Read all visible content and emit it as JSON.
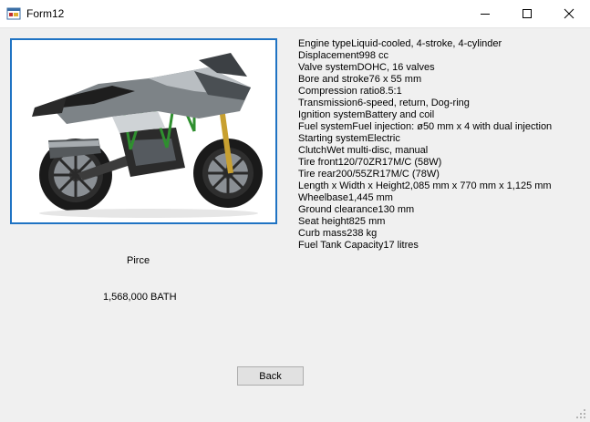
{
  "window": {
    "title": "Form12",
    "icon": "form-app-icon",
    "controls": [
      "minimize-icon",
      "maximize-icon",
      "close-icon"
    ]
  },
  "image": {
    "subject": "motorcycle-photo",
    "frame_color": "#1f73c3"
  },
  "specs": [
    {
      "label": "Engine type",
      "value": "Liquid-cooled, 4-stroke, 4-cylinder"
    },
    {
      "label": "Displacement",
      "value": "998 cc"
    },
    {
      "label": "Valve system",
      "value": "DOHC, 16 valves"
    },
    {
      "label": "Bore and stroke",
      "value": "76 x 55 mm"
    },
    {
      "label": "Compression ratio",
      "value": "8.5:1"
    },
    {
      "label": "Transmission",
      "value": "6-speed, return, Dog-ring"
    },
    {
      "label": "Ignition system",
      "value": "Battery and coil"
    },
    {
      "label": "Fuel system",
      "value": "Fuel injection: ø50 mm x 4 with dual injection"
    },
    {
      "label": "Starting system",
      "value": "Electric"
    },
    {
      "label": "Clutch",
      "value": "Wet multi-disc, manual"
    },
    {
      "label": "Tire front",
      "value": "120/70ZR17M/C (58W)"
    },
    {
      "label": "Tire rear",
      "value": "200/55ZR17M/C (78W)"
    },
    {
      "label": "Length x Width x Height",
      "value": "2,085 mm x 770 mm x 1,125 mm"
    },
    {
      "label": "Wheelbase",
      "value": "1,445 mm"
    },
    {
      "label": "Ground clearance",
      "value": "130 mm"
    },
    {
      "label": "Seat height",
      "value": "825 mm"
    },
    {
      "label": "Curb mass",
      "value": "238 kg"
    },
    {
      "label": "Fuel Tank Capacity",
      "value": "17 litres"
    }
  ],
  "price": {
    "label": "Pirce",
    "value": "1,568,000 BATH"
  },
  "buttons": {
    "back": "Back"
  }
}
